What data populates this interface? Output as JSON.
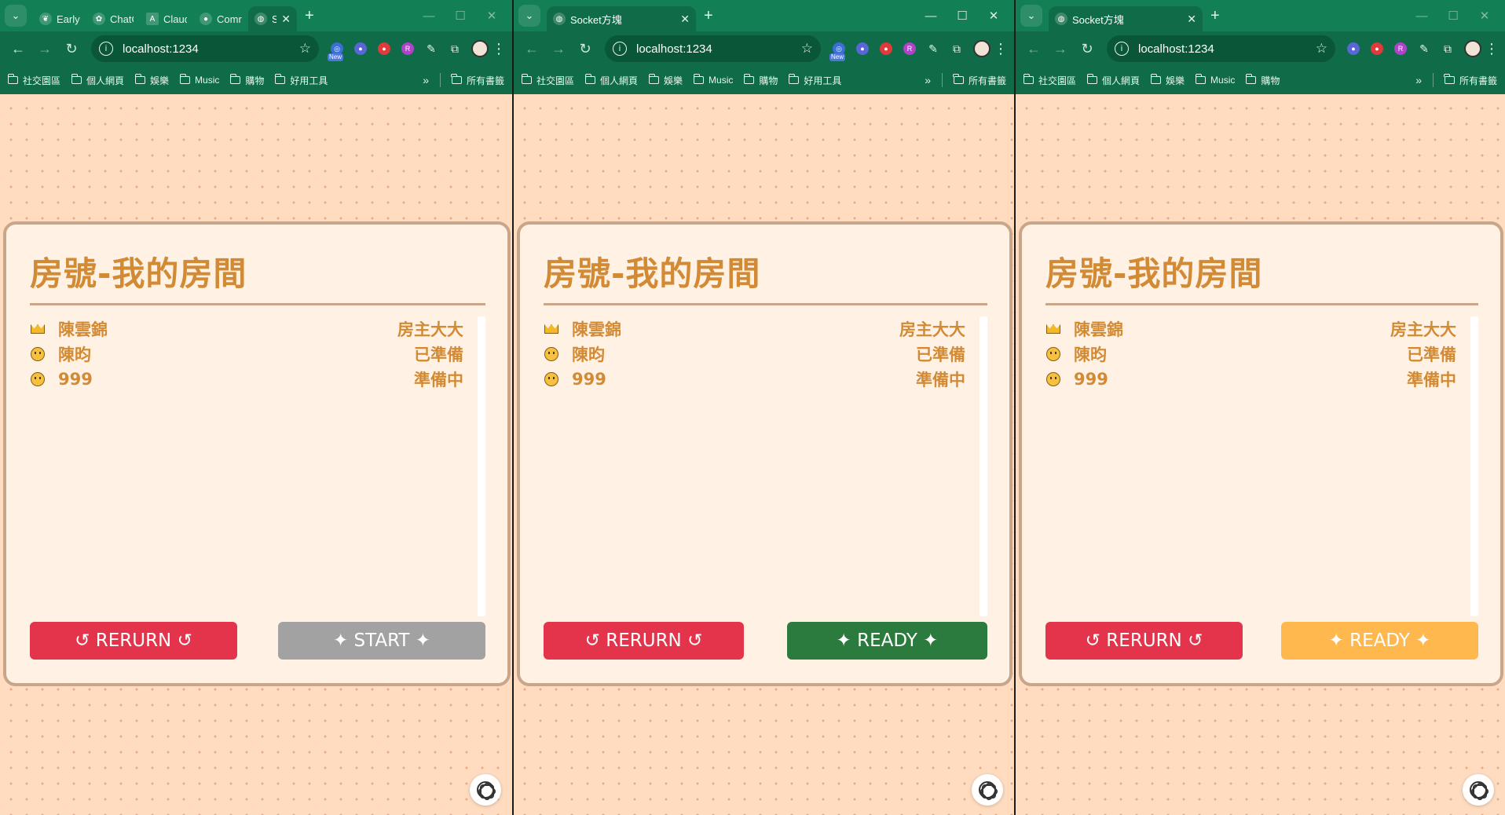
{
  "windows": [
    {
      "tabs": [
        {
          "title": "EarlyB",
          "favicon": "bird-icon"
        },
        {
          "title": "ChatG",
          "favicon": "chatgpt-icon"
        },
        {
          "title": "Claud",
          "favicon": "claude-icon"
        },
        {
          "title": "Comr",
          "favicon": "github-icon"
        },
        {
          "title": "So",
          "favicon": "globe-icon",
          "active": true
        }
      ],
      "url": "localhost:1234",
      "bookmarks": [
        "社交園區",
        "個人網頁",
        "娛樂",
        "Music",
        "購物",
        "好用工具"
      ],
      "all_bookmarks": "所有書籤",
      "room_title": "房號-我的房間",
      "players": [
        {
          "name": "陳雲錦",
          "status": "房主大大",
          "role": "host"
        },
        {
          "name": "陳昀",
          "status": "已準備",
          "role": "player"
        },
        {
          "name": "999",
          "status": "準備中",
          "role": "player"
        }
      ],
      "buttons": {
        "rerun": "↺ RERURN ↺",
        "action": "✦ START ✦"
      },
      "action_color": "#a2a2a2"
    },
    {
      "tabs": [
        {
          "title": "Socket方塊",
          "favicon": "globe-icon",
          "active": true
        }
      ],
      "url": "localhost:1234",
      "bookmarks": [
        "社交園區",
        "個人網頁",
        "娛樂",
        "Music",
        "購物",
        "好用工具"
      ],
      "all_bookmarks": "所有書籤",
      "room_title": "房號-我的房間",
      "players": [
        {
          "name": "陳雲錦",
          "status": "房主大大",
          "role": "host"
        },
        {
          "name": "陳昀",
          "status": "已準備",
          "role": "player"
        },
        {
          "name": "999",
          "status": "準備中",
          "role": "player"
        }
      ],
      "buttons": {
        "rerun": "↺ RERURN ↺",
        "action": "✦ READY ✦"
      },
      "action_color": "#2b7a3e"
    },
    {
      "tabs": [
        {
          "title": "Socket方塊",
          "favicon": "globe-icon",
          "active": true
        }
      ],
      "url": "localhost:1234",
      "bookmarks": [
        "社交園區",
        "個人網頁",
        "娛樂",
        "Music",
        "購物"
      ],
      "all_bookmarks": "所有書籤",
      "room_title": "房號-我的房間",
      "players": [
        {
          "name": "陳雲錦",
          "status": "房主大大",
          "role": "host"
        },
        {
          "name": "陳昀",
          "status": "已準備",
          "role": "player"
        },
        {
          "name": "999",
          "status": "準備中",
          "role": "player"
        }
      ],
      "buttons": {
        "rerun": "↺ RERURN ↺",
        "action": "✦ READY ✦"
      },
      "action_color": "#ffb84d"
    }
  ],
  "colors": {
    "browser_frame": "#127f55",
    "page_background": "#ffdcc0",
    "card_background": "#fff2e4",
    "title_text": "#d38a34",
    "rerun_button": "#e3344b"
  }
}
